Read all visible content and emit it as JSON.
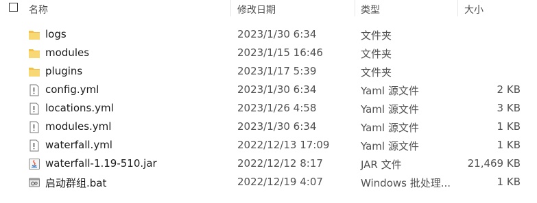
{
  "header": {
    "name": "名称",
    "date": "修改日期",
    "type": "类型",
    "size": "大小"
  },
  "files": [
    {
      "name": "logs",
      "date": "2023/1/30 6:34",
      "type": "文件夹",
      "size": "",
      "icon": "folder-icon"
    },
    {
      "name": "modules",
      "date": "2023/1/15 16:46",
      "type": "文件夹",
      "size": "",
      "icon": "folder-icon"
    },
    {
      "name": "plugins",
      "date": "2023/1/17 5:39",
      "type": "文件夹",
      "size": "",
      "icon": "folder-icon"
    },
    {
      "name": "config.yml",
      "date": "2023/1/30 6:34",
      "type": "Yaml 源文件",
      "size": "2 KB",
      "icon": "yaml-file-icon"
    },
    {
      "name": "locations.yml",
      "date": "2023/1/26 4:58",
      "type": "Yaml 源文件",
      "size": "3 KB",
      "icon": "yaml-file-icon"
    },
    {
      "name": "modules.yml",
      "date": "2023/1/30 6:34",
      "type": "Yaml 源文件",
      "size": "1 KB",
      "icon": "yaml-file-icon"
    },
    {
      "name": "waterfall.yml",
      "date": "2022/12/13 17:09",
      "type": "Yaml 源文件",
      "size": "1 KB",
      "icon": "yaml-file-icon"
    },
    {
      "name": "waterfall-1.19-510.jar",
      "date": "2022/12/12 8:17",
      "type": "JAR 文件",
      "size": "21,469 KB",
      "icon": "java-jar-icon"
    },
    {
      "name": "启动群组.bat",
      "date": "2022/12/19 4:07",
      "type": "Windows 批处理...",
      "size": "1 KB",
      "icon": "batch-file-icon"
    }
  ]
}
